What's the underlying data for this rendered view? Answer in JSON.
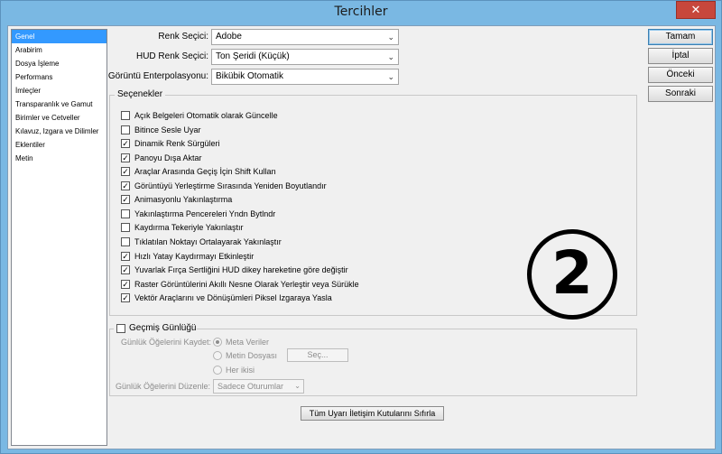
{
  "window": {
    "title": "Tercihler",
    "close_label": "✕"
  },
  "nav": {
    "items": [
      {
        "label": "Genel",
        "selected": true
      },
      {
        "label": "Arabirim"
      },
      {
        "label": "Dosya İşleme"
      },
      {
        "label": "Performans"
      },
      {
        "label": "İmleçler"
      },
      {
        "label": "Transparanlık ve Gamut"
      },
      {
        "label": "Birimler ve Cetveller"
      },
      {
        "label": "Kılavuz, Izgara ve Dilimler"
      },
      {
        "label": "Eklentiler"
      },
      {
        "label": "Metin"
      }
    ]
  },
  "form": {
    "color_picker_label": "Renk Seçici:",
    "color_picker_value": "Adobe",
    "hud_picker_label": "HUD Renk Seçici:",
    "hud_picker_value": "Ton Şeridi (Küçük)",
    "interp_label": "Görüntü Enterpolasyonu:",
    "interp_value": "Bikübik Otomatik"
  },
  "buttons": {
    "ok": "Tamam",
    "cancel": "İptal",
    "prev": "Önceki",
    "next": "Sonraki",
    "reset_warnings": "Tüm Uyarı İletişim Kutularını Sıfırla"
  },
  "options": {
    "title": "Seçenekler",
    "items": [
      {
        "label": "Açık Belgeleri Otomatik olarak Güncelle",
        "checked": false
      },
      {
        "label": "Bitince Sesle Uyar",
        "checked": false
      },
      {
        "label": "Dinamik Renk Sürgüleri",
        "checked": true
      },
      {
        "label": "Panoyu Dışa Aktar",
        "checked": true
      },
      {
        "label": "Araçlar Arasında Geçiş İçin Shift Kullan",
        "checked": true
      },
      {
        "label": "Görüntüyü Yerleştirme Sırasında Yeniden Boyutlandır",
        "checked": true
      },
      {
        "label": "Animasyonlu Yakınlaştırma",
        "checked": true
      },
      {
        "label": "Yakınlaştırma Pencereleri Yndn Bytlndr",
        "checked": false
      },
      {
        "label": "Kaydırma Tekeriyle Yakınlaştır",
        "checked": false
      },
      {
        "label": "Tıklatılan Noktayı Ortalayarak Yakınlaştır",
        "checked": false
      },
      {
        "label": "Hızlı Yatay Kaydırmayı Etkinleştir",
        "checked": true
      },
      {
        "label": "Yuvarlak Fırça Sertliğini HUD dikey hareketine göre değiştir",
        "checked": true
      },
      {
        "label": "Raster Görüntülerini Akıllı Nesne Olarak Yerleştir veya Sürükle",
        "checked": true
      },
      {
        "label": "Vektör Araçlarını ve Dönüşümleri Piksel Izgaraya Yasla",
        "checked": true
      }
    ]
  },
  "history": {
    "title": "Geçmiş Günlüğü",
    "checked": false,
    "save_label": "Günlük Öğelerini Kaydet:",
    "radio_options": [
      {
        "label": "Meta Veriler",
        "selected": true
      },
      {
        "label": "Metin Dosyası",
        "selected": false
      },
      {
        "label": "Her ikisi",
        "selected": false
      }
    ],
    "choose_button": "Seç...",
    "edit_label": "Günlük Öğelerini Düzenle:",
    "edit_value": "Sadece Oturumlar"
  },
  "badge": {
    "number": "2"
  },
  "icons": {
    "check": "✓",
    "chevron": "⌄"
  }
}
